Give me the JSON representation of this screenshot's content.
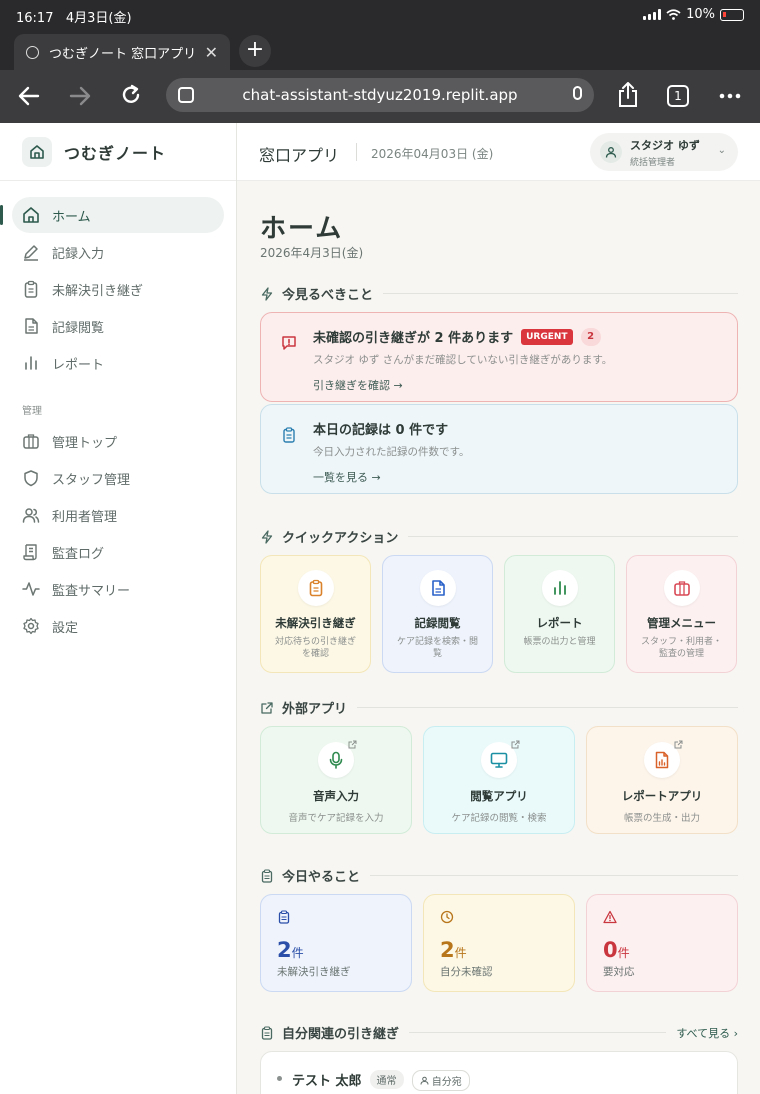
{
  "status_bar": {
    "time": "16:17",
    "date": "4月3日(金)",
    "battery": "10%"
  },
  "browser": {
    "tab_title": "つむぎノート 窓口アプリ",
    "url": "chat-assistant-stdyuz2019.replit.app",
    "tab_count": "1"
  },
  "sidebar": {
    "brand": "つむぎノート",
    "items": [
      {
        "label": "ホーム",
        "icon": "home-icon",
        "active": true
      },
      {
        "label": "記録入力",
        "icon": "pencil-icon"
      },
      {
        "label": "未解決引き継ぎ",
        "icon": "clipboard-icon"
      },
      {
        "label": "記録閲覧",
        "icon": "document-icon"
      },
      {
        "label": "レポート",
        "icon": "bar-chart-icon"
      }
    ],
    "section_label": "管理",
    "admin_items": [
      {
        "label": "管理トップ",
        "icon": "briefcase-icon"
      },
      {
        "label": "スタッフ管理",
        "icon": "shield-icon"
      },
      {
        "label": "利用者管理",
        "icon": "users-icon"
      },
      {
        "label": "監査ログ",
        "icon": "scroll-icon"
      },
      {
        "label": "監査サマリー",
        "icon": "activity-icon"
      },
      {
        "label": "設定",
        "icon": "gear-icon"
      }
    ]
  },
  "header": {
    "title": "窓口アプリ",
    "date": "2026年04月03日 (金)",
    "user_name": "スタジオ ゆず",
    "user_role": "統括管理者"
  },
  "main": {
    "page_title": "ホーム",
    "page_date": "2026年4月3日(金)",
    "section_now": "今見るべきこと",
    "alert_urgent": {
      "title": "未確認の引き継ぎが 2 件あります",
      "badge": "URGENT",
      "count": "2",
      "desc": "スタジオ ゆず さんがまだ確認していない引き継ぎがあります。",
      "link": "引き継ぎを確認 →"
    },
    "alert_info": {
      "title": "本日の記録は 0 件です",
      "desc": "今日入力された記録の件数です。",
      "link": "一覧を見る →"
    },
    "section_quick": "クイックアクション",
    "quick_actions": [
      {
        "title": "未解決引き継ぎ",
        "desc": "対応待ちの引き継ぎを確認",
        "icon": "clipboard-icon",
        "color": "#d9822b"
      },
      {
        "title": "記録閲覧",
        "desc": "ケア記録を検索・閲覧",
        "icon": "document-icon",
        "color": "#2b62c9"
      },
      {
        "title": "レポート",
        "desc": "帳票の出力と管理",
        "icon": "bar-chart-icon",
        "color": "#2f8a4f"
      },
      {
        "title": "管理メニュー",
        "desc": "スタッフ・利用者・監査の管理",
        "icon": "briefcase-icon",
        "color": "#d94a57"
      }
    ],
    "section_external": "外部アプリ",
    "external_apps": [
      {
        "title": "音声入力",
        "desc": "音声でケア記録を入力",
        "icon": "mic-icon",
        "color": "#2f8a4f"
      },
      {
        "title": "閲覧アプリ",
        "desc": "ケア記録の閲覧・検索",
        "icon": "monitor-icon",
        "color": "#1a8fa3"
      },
      {
        "title": "レポートアプリ",
        "desc": "帳票の生成・出力",
        "icon": "report-file-icon",
        "color": "#d9622b"
      }
    ],
    "section_today": "今日やること",
    "todos": [
      {
        "value": "2",
        "unit": "件",
        "label": "未解決引き継ぎ",
        "icon": "clipboard-icon",
        "color": "#2b4fa8"
      },
      {
        "value": "2",
        "unit": "件",
        "label": "自分未確認",
        "icon": "clock-icon",
        "color": "#b8761b"
      },
      {
        "value": "0",
        "unit": "件",
        "label": "要対応",
        "icon": "warning-icon",
        "color": "#c9363e"
      }
    ],
    "section_related": "自分関連の引き継ぎ",
    "see_all": "すべて見る ›",
    "related_item": {
      "name": "テスト 太郎",
      "tag1": "通常",
      "tag2": "自分宛"
    }
  }
}
